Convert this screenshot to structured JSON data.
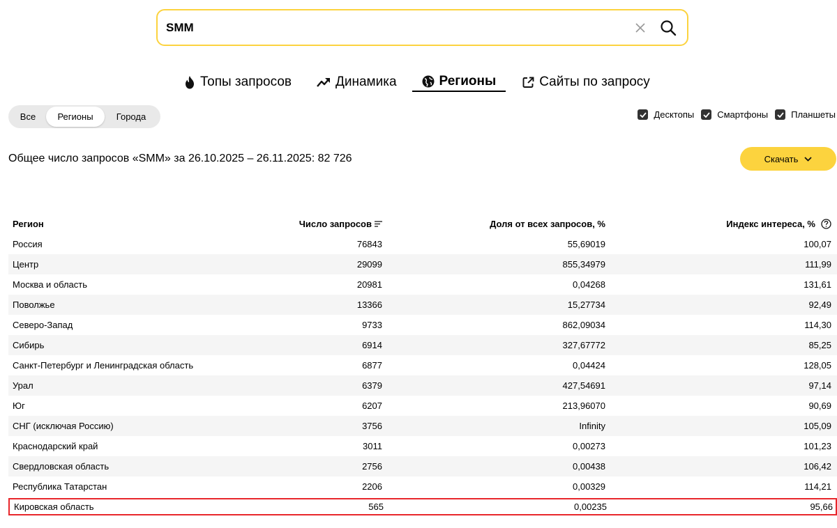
{
  "search": {
    "value": "SMM"
  },
  "tabs": [
    {
      "label": "Топы запросов",
      "icon": "fire-icon"
    },
    {
      "label": "Динамика",
      "icon": "trend-up-icon"
    },
    {
      "label": "Регионы",
      "icon": "globe-icon",
      "active": true
    },
    {
      "label": "Сайты по запросу",
      "icon": "external-link-icon"
    }
  ],
  "region_filter": {
    "options": [
      "Все",
      "Регионы",
      "Города"
    ],
    "selected": "Регионы"
  },
  "devices": [
    {
      "label": "Десктопы",
      "checked": true
    },
    {
      "label": "Смартфоны",
      "checked": true
    },
    {
      "label": "Планшеты",
      "checked": true
    }
  ],
  "summary": {
    "text": "Общее число запросов «SMM» за 26.10.2025 – 26.11.2025: 82 726"
  },
  "download": {
    "label": "Скачать"
  },
  "table": {
    "headers": [
      "Регион",
      "Число запросов",
      "Доля от всех запросов, %",
      "Индекс интереса, %"
    ],
    "rows": [
      [
        "Россия",
        "76843",
        "55,69019",
        "100,07"
      ],
      [
        "Центр",
        "29099",
        "855,34979",
        "111,99"
      ],
      [
        "Москва и область",
        "20981",
        "0,04268",
        "131,61"
      ],
      [
        "Поволжье",
        "13366",
        "15,27734",
        "92,49"
      ],
      [
        "Северо-Запад",
        "9733",
        "862,09034",
        "114,30"
      ],
      [
        "Сибирь",
        "6914",
        "327,67772",
        "85,25"
      ],
      [
        "Санкт-Петербург и Ленинградская область",
        "6877",
        "0,04424",
        "128,05"
      ],
      [
        "Урал",
        "6379",
        "427,54691",
        "97,14"
      ],
      [
        "Юг",
        "6207",
        "213,96070",
        "90,69"
      ],
      [
        "СНГ (исключая Россию)",
        "3756",
        "Infinity",
        "105,09"
      ],
      [
        "Краснодарский край",
        "3011",
        "0,00273",
        "101,23"
      ],
      [
        "Свердловская область",
        "2756",
        "0,00438",
        "106,42"
      ],
      [
        "Республика Татарстан",
        "2206",
        "0,00329",
        "114,21"
      ],
      [
        "Кировская область",
        "565",
        "0,00235",
        "95,66"
      ]
    ]
  },
  "colors": {
    "accent": "#fcd33e",
    "highlight_border": "#e8262b",
    "row_stripe": "#f5f5f5"
  }
}
